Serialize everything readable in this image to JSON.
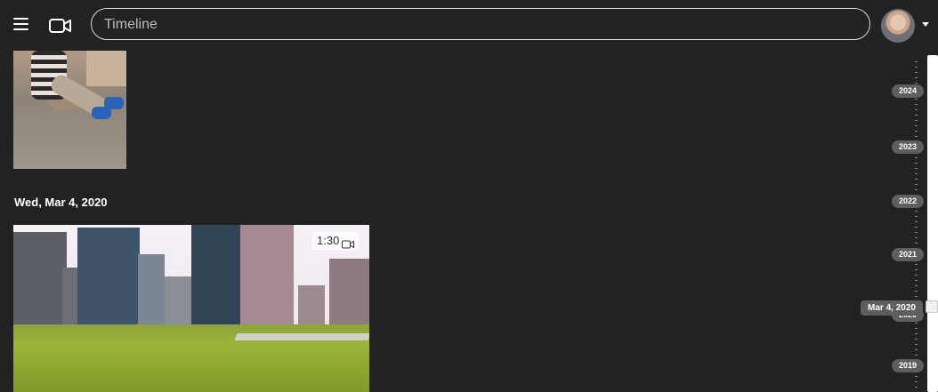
{
  "header": {
    "search_placeholder": "Timeline",
    "icons": [
      "menu-icon",
      "video-camera-icon",
      "avatar",
      "caret-down-icon"
    ]
  },
  "content": {
    "date_heading": "Wed, Mar 4, 2020",
    "video_duration": "1:30"
  },
  "timeline": {
    "years": [
      "2024",
      "2023",
      "2022",
      "2021",
      "2020",
      "2019"
    ],
    "current_date": "Mar 4, 2020"
  },
  "colors": {
    "background": "#222222",
    "year_pill": "#5e5e5e"
  }
}
